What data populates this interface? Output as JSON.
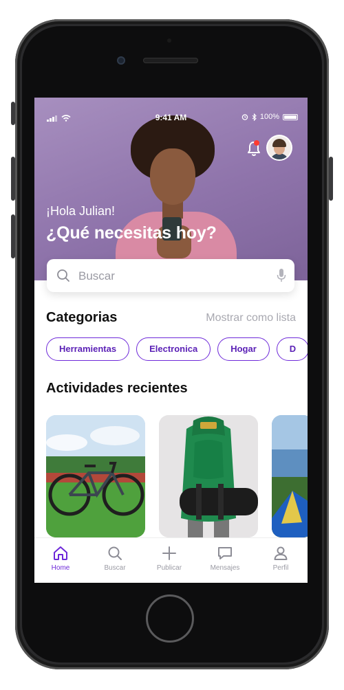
{
  "status_bar": {
    "time": "9:41 AM",
    "battery": "100%"
  },
  "header": {
    "greeting": "¡Hola Julian!",
    "question": "¿Qué necesitas hoy?",
    "has_notification": true
  },
  "search": {
    "placeholder": "Buscar"
  },
  "categories": {
    "title": "Categorias",
    "show_as_list": "Mostrar como lista",
    "items": [
      {
        "label": "Herramientas"
      },
      {
        "label": "Electronica"
      },
      {
        "label": "Hogar"
      },
      {
        "label": "D"
      }
    ]
  },
  "recent": {
    "title": "Actividades recientes"
  },
  "tabbar": {
    "items": [
      {
        "label": "Home",
        "icon": "home-icon",
        "active": true
      },
      {
        "label": "Buscar",
        "icon": "search-icon",
        "active": false
      },
      {
        "label": "Publicar",
        "icon": "plus-icon",
        "active": false
      },
      {
        "label": "Mensajes",
        "icon": "chat-icon",
        "active": false
      },
      {
        "label": "Perfil",
        "icon": "user-icon",
        "active": false
      }
    ]
  },
  "colors": {
    "accent": "#6d28d9",
    "hero": "#8f74ab",
    "notification": "#ff3b30"
  }
}
